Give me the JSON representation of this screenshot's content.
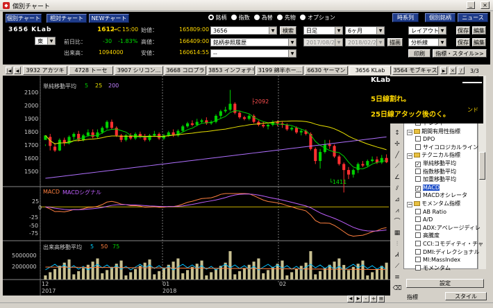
{
  "window": {
    "title": "個別チャート"
  },
  "top_buttons": [
    "個別チャート",
    "相対チャート",
    "NEWチャート"
  ],
  "radio": [
    {
      "label": "銘柄",
      "sel": true
    },
    {
      "label": "指数",
      "sel": false
    },
    {
      "label": "為替",
      "sel": false
    },
    {
      "label": "先物",
      "sel": false
    },
    {
      "label": "オプション",
      "sel": false
    }
  ],
  "right_buttons": [
    "時系列",
    "個別銘柄",
    "ニュース"
  ],
  "stock": {
    "code_name": "3656 KLab",
    "price": "1612",
    "arrow": "→C",
    "time": "15:00",
    "open_label": "始値：",
    "open": "1658",
    "open_time": "09:00",
    "prev_label": "前日比：",
    "change": "-30",
    "change_pct": "-1.83%",
    "high_label": "高値：",
    "high": "1664",
    "high_time": "09:00",
    "volume_label": "出来高：",
    "volume": "1094000",
    "low_label": "安値：",
    "low": "1606",
    "low_time": "14:55",
    "market": "東"
  },
  "controls": {
    "code_input": "3656",
    "search_btn": "検索",
    "ref_select": "銘柄参照履歴",
    "blank_select": "--",
    "period": "日足",
    "range": "6ヶ月",
    "date_from": "2017/08/28",
    "date_to": "2018/02/28",
    "draw_btn": "描画",
    "layout": "レイアウト",
    "save1": "保存",
    "edit1": "編集",
    "analysis": "分析線",
    "save2": "保存",
    "edit2": "編集",
    "print": "印刷",
    "style_btn": "指標・スタイル>>"
  },
  "tabs": [
    "3932 アカツキ",
    "4728 トーセ",
    "3907 シリコン...",
    "3668 コロプラ",
    "3853 インフォテリ",
    "3199 綿半ホー...",
    "6630 ヤーマン",
    "3656 KLab",
    "3564 モブキャス"
  ],
  "tab_page": "3/3",
  "main_chart": {
    "legend_label": "単純移動平均",
    "ma": [
      "5",
      "25",
      "200"
    ],
    "y_ticks": [
      "2100",
      "2000",
      "1900",
      "1800",
      "1700",
      "1600",
      "1500"
    ],
    "high_mark": "2092",
    "low_mark": "1411"
  },
  "macd_chart": {
    "legend": [
      "MACD",
      "MACDシグナル"
    ],
    "y_ticks": [
      "25",
      "0",
      "-25",
      "-50",
      "-75"
    ]
  },
  "vol_chart": {
    "legend_label": "出来高移動平均",
    "ma": [
      "5",
      "50",
      "75"
    ],
    "y_ticks": [
      "5000000",
      "2000000"
    ]
  },
  "x_axis": {
    "months": [
      "12",
      "01",
      "02"
    ],
    "years": [
      "2017",
      "2018"
    ]
  },
  "annotation": {
    "title": "KLab",
    "line1": "5日線割れ。",
    "line2": "25日線アタック後のく。",
    "tail": "ンド"
  },
  "tree": [
    {
      "label": "トレンド",
      "type": "item",
      "check": false
    },
    {
      "label": "期間有用性指標",
      "type": "group"
    },
    {
      "label": "DPO",
      "type": "item",
      "check": false
    },
    {
      "label": "サイコロジカルライン",
      "type": "item",
      "check": false
    },
    {
      "label": "テクニカル指標",
      "type": "group"
    },
    {
      "label": "単純移動平均",
      "type": "item",
      "check": true
    },
    {
      "label": "指数移動平均",
      "type": "item",
      "check": false
    },
    {
      "label": "加重移動平均",
      "type": "item",
      "check": false
    },
    {
      "label": "MACD",
      "type": "item",
      "check": true,
      "hl": true
    },
    {
      "label": "MACDオシレータ",
      "type": "item",
      "check": false
    },
    {
      "label": "モメンタム指標",
      "type": "group"
    },
    {
      "label": "AB Ratio",
      "type": "item",
      "check": false
    },
    {
      "label": "A/D",
      "type": "item",
      "check": false
    },
    {
      "label": "ADX:アベレージディレ",
      "type": "item",
      "check": false
    },
    {
      "label": "高騰度",
      "type": "item",
      "check": false
    },
    {
      "label": "CCI:コモディティ・チャ",
      "type": "item",
      "check": false
    },
    {
      "label": "DMI:ディレクショナル",
      "type": "item",
      "check": false
    },
    {
      "label": "MI:MassIndex",
      "type": "item",
      "check": false
    },
    {
      "label": "モメンタム",
      "type": "item",
      "check": false
    }
  ],
  "panel": {
    "settings_btn": "設定",
    "indicator_label": "指標",
    "style_tab": "スタイル"
  },
  "chart_data": {
    "type": "candlestick",
    "y_range": [
      1450,
      2150
    ],
    "x_labels": [
      "12",
      "01",
      "02"
    ],
    "candles": [
      [
        1760,
        1790,
        1730,
        1720
      ],
      [
        1780,
        1720,
        1800,
        1690
      ],
      [
        1715,
        1690,
        1740,
        1680
      ],
      [
        1690,
        1760,
        1770,
        1685
      ],
      [
        1760,
        1740,
        1775,
        1720
      ],
      [
        1740,
        1780,
        1790,
        1730
      ],
      [
        1780,
        1800,
        1810,
        1760
      ],
      [
        1800,
        1760,
        1820,
        1750
      ],
      [
        1760,
        1790,
        1800,
        1750
      ],
      [
        1790,
        1810,
        1830,
        1780
      ],
      [
        1810,
        1780,
        1830,
        1770
      ],
      [
        1780,
        1810,
        1830,
        1770
      ],
      [
        1810,
        1840,
        1850,
        1800
      ],
      [
        1840,
        1880,
        1890,
        1830
      ],
      [
        1880,
        1840,
        1895,
        1830
      ],
      [
        1840,
        1790,
        1850,
        1780
      ],
      [
        1790,
        1760,
        1800,
        1745
      ],
      [
        1760,
        1790,
        1800,
        1750
      ],
      [
        1790,
        1770,
        1805,
        1760
      ],
      [
        1770,
        1800,
        1810,
        1760
      ],
      [
        1800,
        1780,
        1815,
        1770
      ],
      [
        1780,
        1760,
        1800,
        1750
      ],
      [
        1760,
        1790,
        1800,
        1750
      ],
      [
        1790,
        1800,
        1820,
        1780
      ],
      [
        1800,
        1770,
        1810,
        1760
      ],
      [
        1770,
        1790,
        1800,
        1760
      ],
      [
        1790,
        1810,
        1820,
        1780
      ],
      [
        1810,
        1790,
        1830,
        1780
      ],
      [
        1790,
        1820,
        1830,
        1780
      ],
      [
        1820,
        1850,
        1860,
        1810
      ],
      [
        1850,
        1870,
        1880,
        1840
      ],
      [
        1870,
        1860,
        1890,
        1850
      ],
      [
        1860,
        1880,
        1900,
        1850
      ],
      [
        1880,
        1890,
        1900,
        1870
      ],
      [
        1890,
        1870,
        1910,
        1860
      ],
      [
        1870,
        1880,
        1890,
        1860
      ],
      [
        1880,
        1920,
        1930,
        1870
      ],
      [
        1920,
        1950,
        1960,
        1900
      ],
      [
        1950,
        1960,
        1980,
        1940
      ],
      [
        1960,
        2000,
        2092,
        1950
      ],
      [
        2000,
        1940,
        2010,
        1930
      ],
      [
        1940,
        1910,
        1950,
        1900
      ],
      [
        1910,
        1900,
        1920,
        1890
      ],
      [
        1900,
        1920,
        1930,
        1890
      ],
      [
        1920,
        1880,
        1930,
        1870
      ],
      [
        1880,
        1860,
        1890,
        1850
      ],
      [
        1860,
        1850,
        1880,
        1840
      ],
      [
        1850,
        1860,
        1870,
        1830
      ],
      [
        1860,
        1880,
        1890,
        1850
      ],
      [
        1880,
        1870,
        1890,
        1850
      ],
      [
        1870,
        1860,
        1880,
        1840
      ],
      [
        1860,
        1830,
        1870,
        1820
      ],
      [
        1830,
        1840,
        1850,
        1820
      ],
      [
        1840,
        1810,
        1850,
        1800
      ],
      [
        1810,
        1820,
        1830,
        1790
      ],
      [
        1820,
        1800,
        1830,
        1790
      ],
      [
        1800,
        1700,
        1810,
        1690
      ],
      [
        1700,
        1620,
        1710,
        1600
      ],
      [
        1620,
        1680,
        1700,
        1570
      ],
      [
        1680,
        1730,
        1760,
        1670
      ],
      [
        1730,
        1720,
        1760,
        1700
      ],
      [
        1720,
        1650,
        1730,
        1640
      ],
      [
        1650,
        1600,
        1660,
        1590
      ],
      [
        1600,
        1560,
        1610,
        1411
      ],
      [
        1560,
        1530,
        1580,
        1500
      ],
      [
        1530,
        1560,
        1570,
        1510
      ],
      [
        1560,
        1600,
        1610,
        1540
      ],
      [
        1600,
        1590,
        1620,
        1580
      ],
      [
        1590,
        1620,
        1630,
        1580
      ],
      [
        1620,
        1630,
        1650,
        1610
      ],
      [
        1630,
        1610,
        1650,
        1600
      ],
      [
        1610,
        1640,
        1660,
        1600
      ],
      [
        1640,
        1612,
        1664,
        1606
      ]
    ]
  }
}
